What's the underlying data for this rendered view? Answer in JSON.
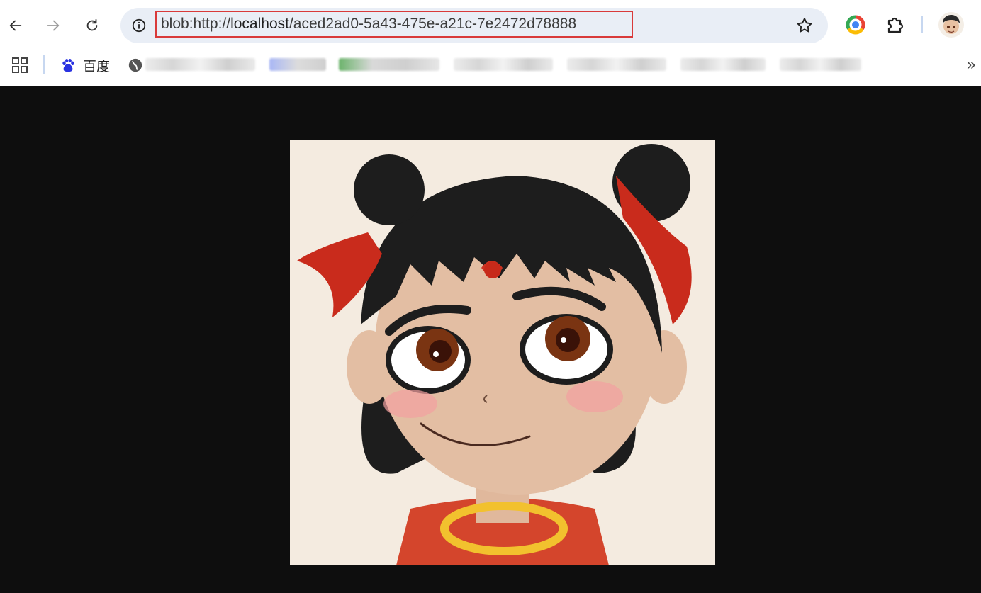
{
  "browser": {
    "url_prefix": "blob:http://",
    "url_host": "localhost",
    "url_path": "/aced2ad0-5a43-475e-a21c-7e2472d78888",
    "icons": [
      "back-arrow-icon",
      "forward-arrow-icon",
      "reload-icon",
      "site-info-icon",
      "star-icon",
      "chrome-extension-icon",
      "puzzle-icon"
    ]
  },
  "bookmarks": {
    "items": [
      {
        "label": "百度",
        "icon": "baidu-paw-icon"
      }
    ]
  },
  "colors": {
    "page_background": "#0e0e0e",
    "omnibox": "#e9eef6",
    "highlight_border": "#d93a3a",
    "image_background": "#f4ebe0"
  }
}
